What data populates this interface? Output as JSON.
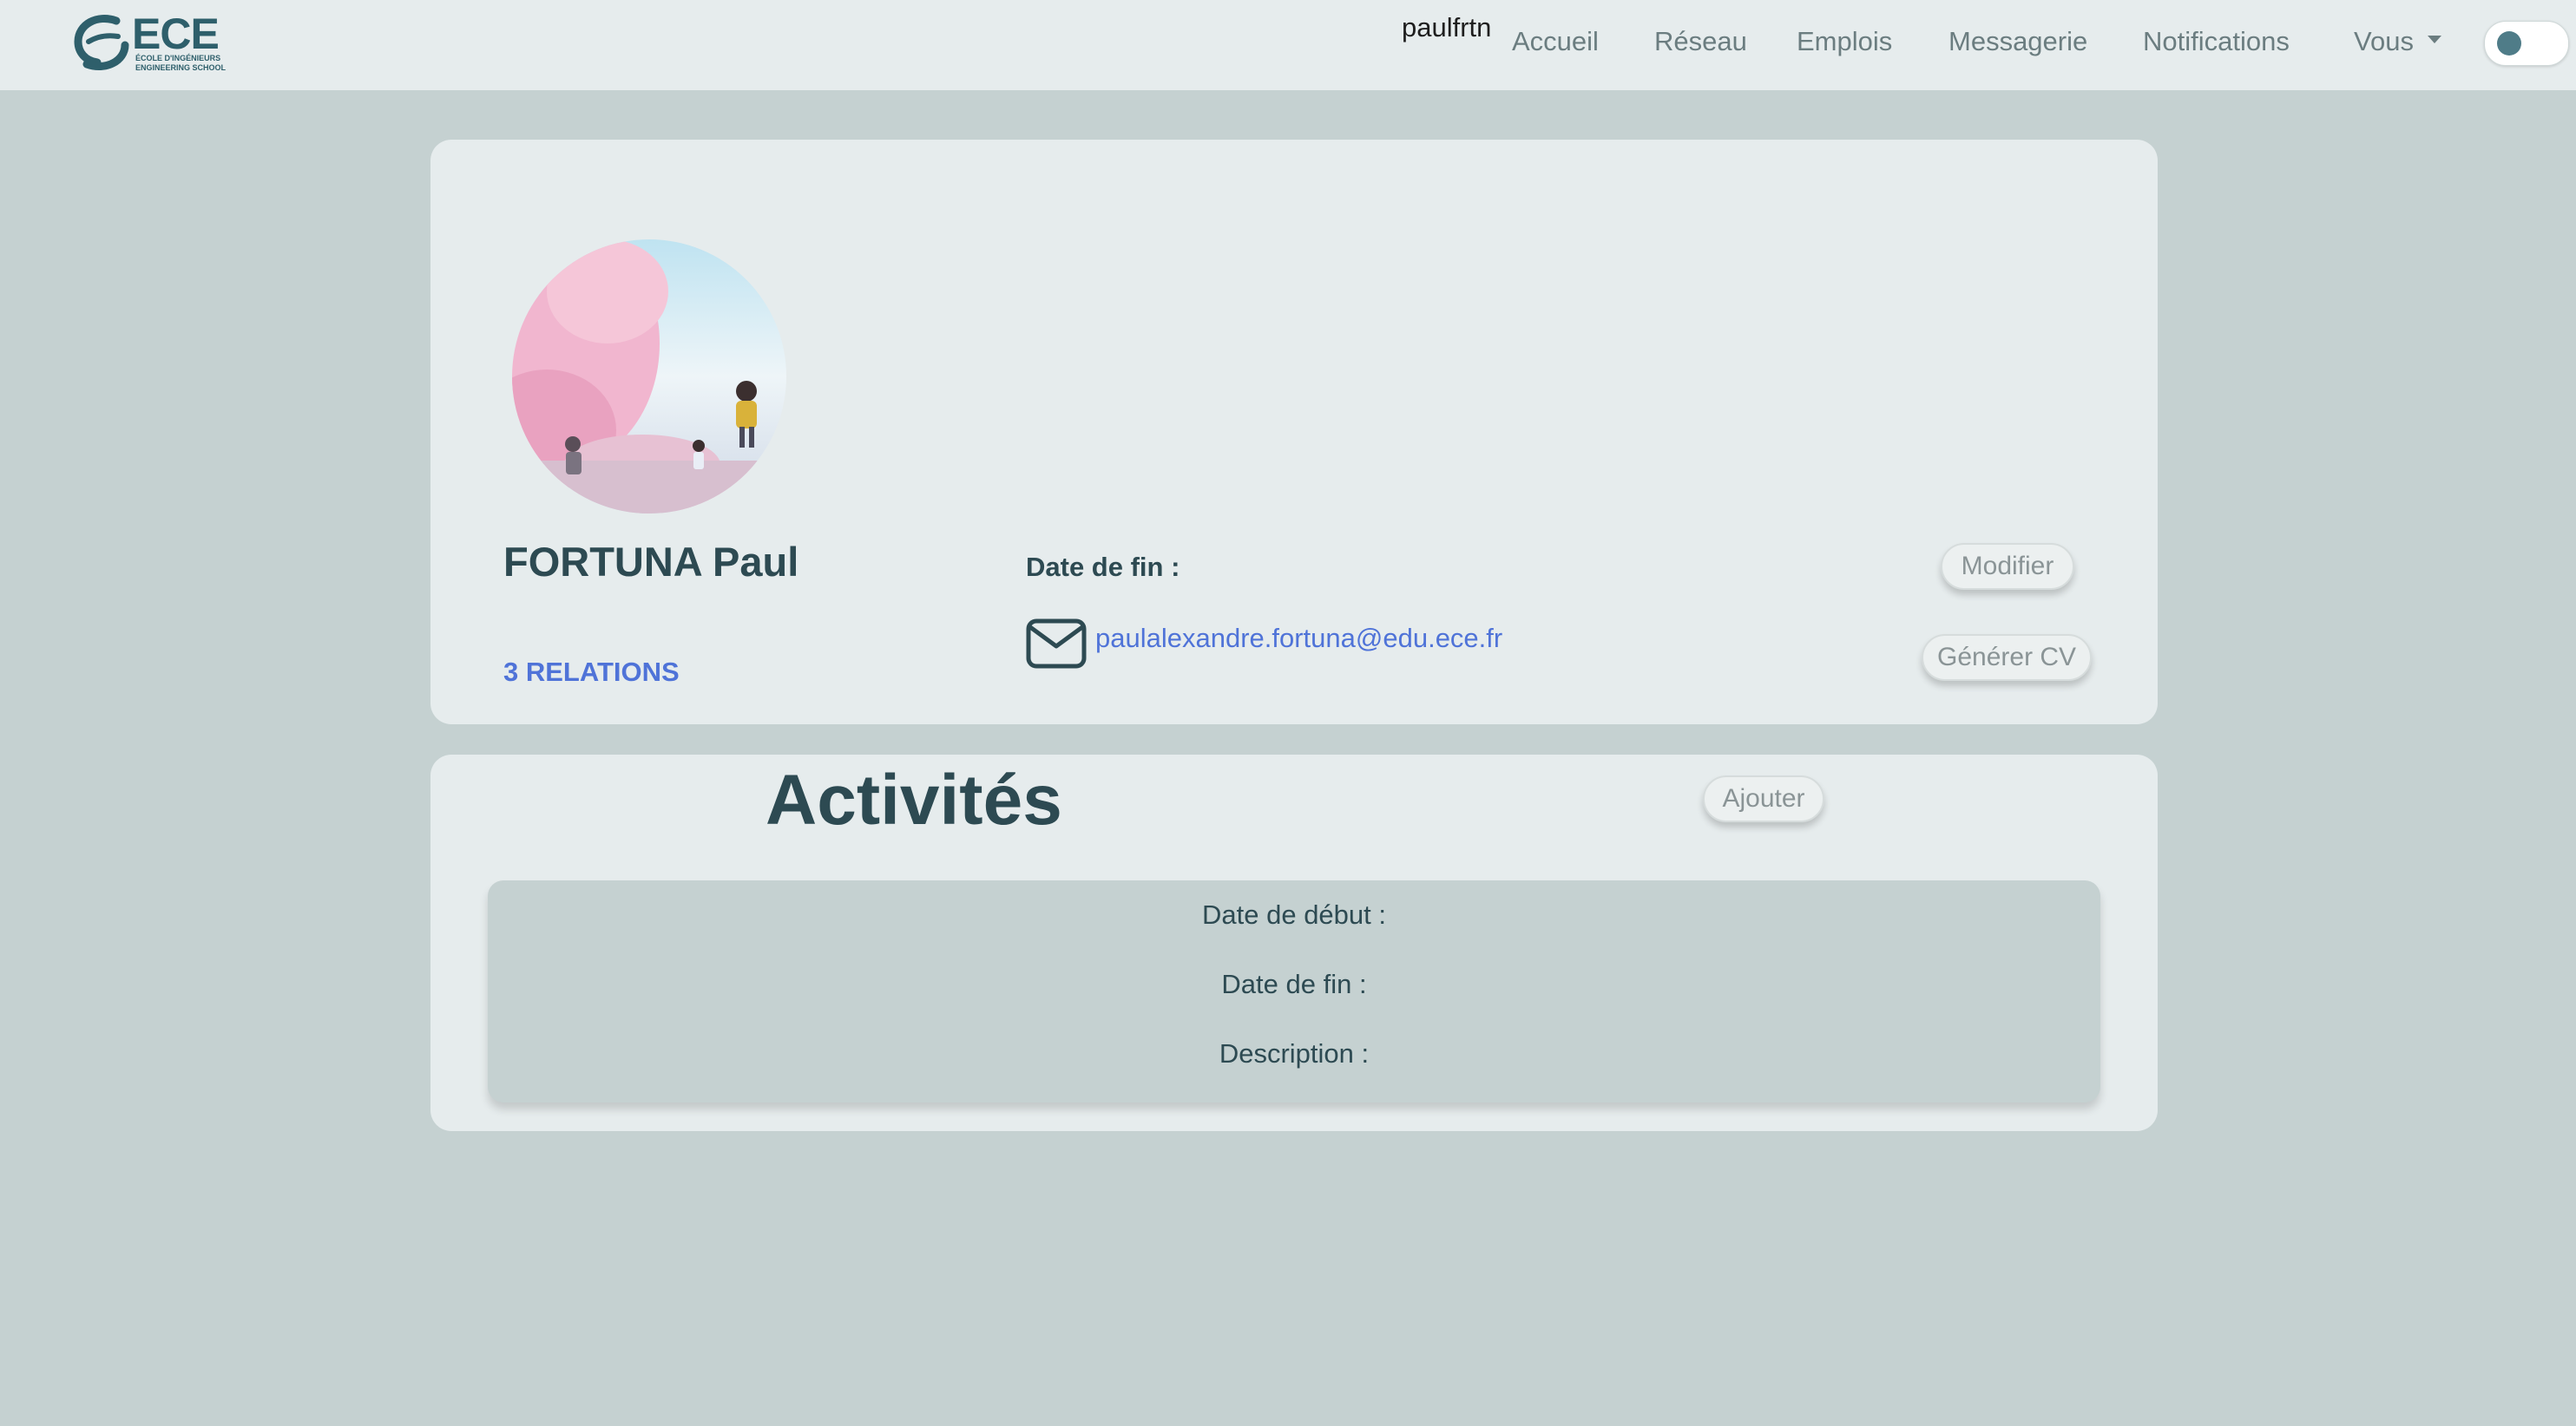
{
  "nav": {
    "logo_text": "ECE",
    "logo_sub1": "ÉCOLE D'INGÉNIEURS",
    "logo_sub2": "ENGINEERING SCHOOL",
    "username": "paulfrtn",
    "links": [
      "Accueil",
      "Réseau",
      "Emplois",
      "Messagerie",
      "Notifications",
      "Vous"
    ]
  },
  "profile": {
    "name": "FORTUNA Paul",
    "relations": "3 RELATIONS",
    "date_fin_label": "Date de fin :",
    "email": "paulalexandre.fortuna@edu.ece.fr",
    "modifier_label": "Modifier",
    "cv_label": "Générer CV"
  },
  "activities": {
    "title": "Activités",
    "add_label": "Ajouter",
    "entry": {
      "date_debut": "Date de début :",
      "date_fin": "Date de fin :",
      "description": "Description :"
    }
  },
  "icons": {
    "mail": "envelope-icon",
    "avatar": "profile-photo",
    "toggle": "theme-toggle"
  },
  "colors": {
    "background": "#c5d1d1",
    "card": "#e6eced",
    "link": "#4f73d8",
    "text": "#2d4a52"
  }
}
